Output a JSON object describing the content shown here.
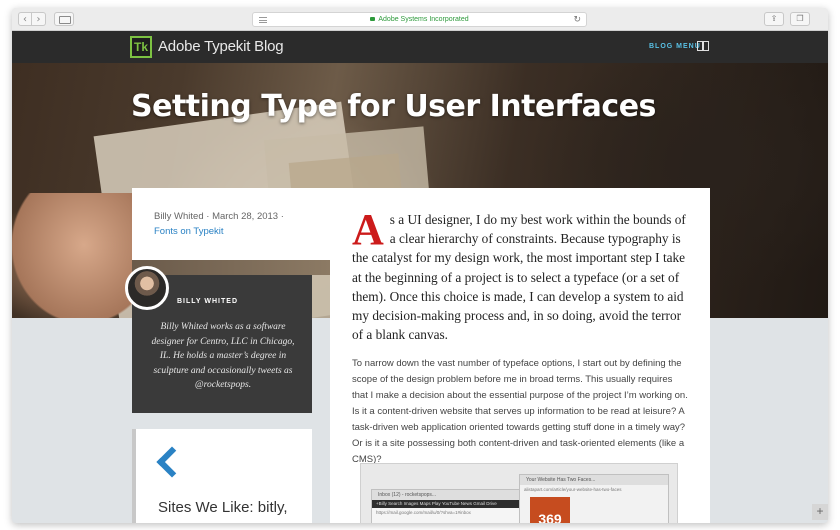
{
  "browser": {
    "address_text": "Adobe Systems Incorporated",
    "back_glyph": "‹",
    "forward_glyph": "›",
    "reload_glyph": "↻",
    "share_glyph": "⇪",
    "tabs_glyph": "❐",
    "newtab_glyph": "+"
  },
  "blog": {
    "logo_text": "Tk",
    "title": "Adobe Typekit Blog",
    "menu_label": "BLOG MENU"
  },
  "hero": {
    "title": "Setting Type for User Interfaces"
  },
  "meta": {
    "byline": "Billy Whited · March 28, 2013 ·",
    "category_link": "Fonts on Typekit"
  },
  "author": {
    "name": "BILLY WHITED",
    "bio": "Billy Whited works as a software designer for Centro, LLC in Chicago, IL. He holds a master’s degree in sculpture and occasionally tweets as @rocketspops."
  },
  "sites": {
    "label": "Sites We Like: bitly,"
  },
  "article": {
    "dropcap": "A",
    "lead": "s a UI designer, I do my best work within the bounds of a clear hierarchy of constraints. Because typography is the catalyst for my design work, the most important step I take at the beginning of a project is to select a typeface (or a set of them). Once this choice is made, I can develop a system to aid my decision-making process and, in so doing, avoid the terror of a blank canvas.",
    "paragraph": "To narrow down the vast number of typeface options, I start out by defining the scope of the design problem before me in broad terms. This usually requires that I make a decision about the essential purpose of the project I’m working on. Is it a content-driven website that serves up information to be read at leisure? A task-driven web application oriented towards getting stuff done in a timely way? Or is it a site possessing both content-driven and task-oriented elements (like a CMS)?",
    "screenshot": {
      "left_tab": "Inbox (12) - rocketspops...",
      "left_url": "https://mail.google.com/mail/u/0/?shva=1#inbox",
      "left_nav": "+Billy  Search  Images  Maps  Play  YouTube  News  Gmail  Drive",
      "right_tab": "Your Website Has Two Faces...",
      "right_url": "alistapart.com/article/your-website-has-two-faces",
      "poster_text": "369"
    }
  }
}
